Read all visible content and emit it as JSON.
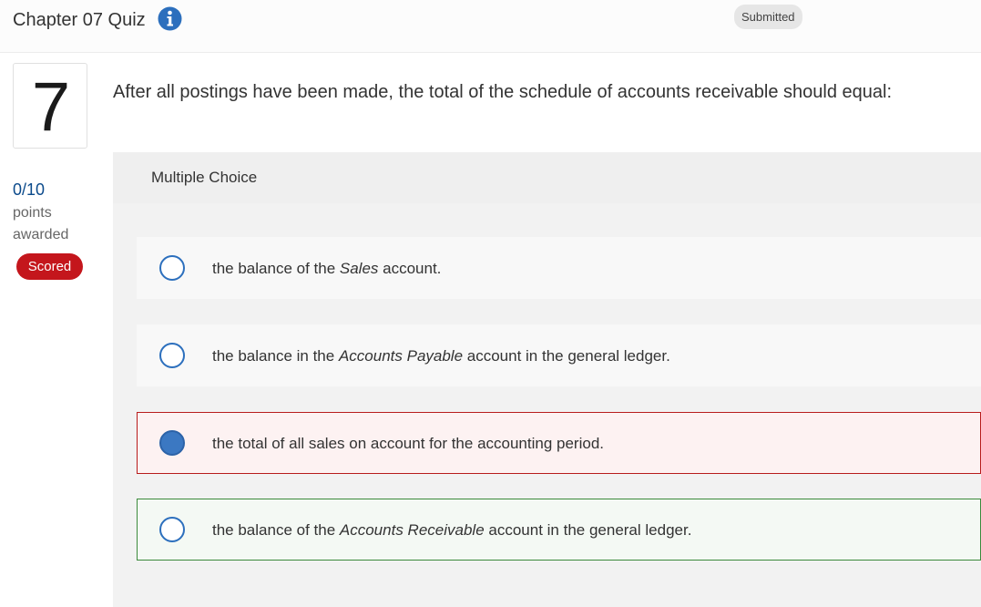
{
  "header": {
    "title": "Chapter 07 Quiz",
    "info_icon": "info-icon",
    "status": "Submitted"
  },
  "question": {
    "number": "7",
    "score": "0/10",
    "points_label": "points awarded",
    "scored_badge": "Scored",
    "text": "After all postings have been made, the total of the schedule of accounts receivable should equal:"
  },
  "panel": {
    "title": "Multiple Choice"
  },
  "choices": [
    {
      "pre": "the balance of the ",
      "em": "Sales",
      "post": " account.",
      "selected": false,
      "state": "neutral"
    },
    {
      "pre": "the balance in the ",
      "em": "Accounts Payable",
      "post": " account in the general ledger.",
      "selected": false,
      "state": "neutral"
    },
    {
      "pre": "the total of all sales on account for the accounting period.",
      "em": "",
      "post": "",
      "selected": true,
      "state": "incorrect"
    },
    {
      "pre": "the balance of the ",
      "em": "Accounts Receivable",
      "post": " account in the general ledger.",
      "selected": false,
      "state": "correct"
    }
  ],
  "colors": {
    "accent": "#2c6fbd",
    "score": "#0b4a8b",
    "scored_badge": "#c4161c",
    "incorrect_border": "#b81c1c",
    "correct_border": "#3c8a3c"
  }
}
